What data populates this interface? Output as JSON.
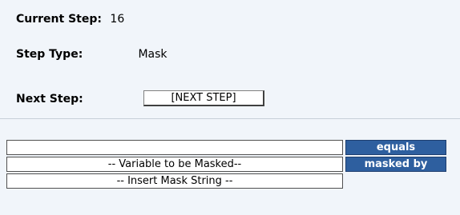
{
  "step": {
    "current_label": "Current Step:",
    "current_value": "16",
    "type_label": "Step Type:",
    "type_value": "Mask",
    "next_label": "Next Step:",
    "next_button": "[NEXT STEP]"
  },
  "condition": {
    "left_operand": "",
    "equals_label": "equals",
    "variable_placeholder": "-- Variable to be Masked--",
    "masked_by_label": "masked by",
    "mask_string_placeholder": "-- Insert Mask String --"
  }
}
